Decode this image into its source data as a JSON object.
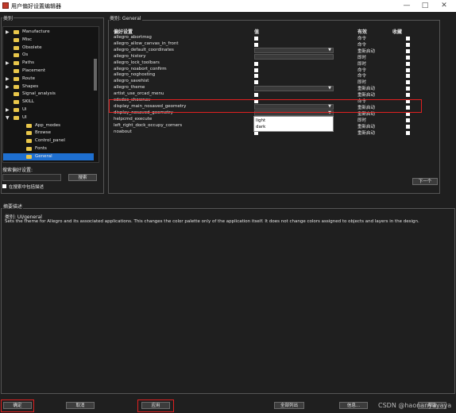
{
  "window": {
    "title": "用户偏好设置编辑器",
    "minimize": "—",
    "maximize": "□",
    "close": "✕"
  },
  "categories_panel": {
    "label": "类别",
    "tree": [
      {
        "label": "Manufacture",
        "expander": "▶",
        "indent": 0
      },
      {
        "label": "Misc",
        "expander": "",
        "indent": 0
      },
      {
        "label": "Obsolete",
        "expander": "",
        "indent": 0
      },
      {
        "label": "Os",
        "expander": "",
        "indent": 0
      },
      {
        "label": "Paths",
        "expander": "▶",
        "indent": 0
      },
      {
        "label": "Placement",
        "expander": "",
        "indent": 0
      },
      {
        "label": "Route",
        "expander": "▶",
        "indent": 0
      },
      {
        "label": "Shapes",
        "expander": "▶",
        "indent": 0
      },
      {
        "label": "Signal_analysis",
        "expander": "",
        "indent": 0
      },
      {
        "label": "SKILL",
        "expander": "",
        "indent": 0
      },
      {
        "label": "Ui",
        "expander": "▶",
        "indent": 0
      },
      {
        "label": "UI",
        "expander": "▼",
        "indent": 0
      },
      {
        "label": "App_modes",
        "expander": "",
        "indent": 1
      },
      {
        "label": "Browse",
        "expander": "",
        "indent": 1
      },
      {
        "label": "Control_panel",
        "expander": "",
        "indent": 1
      },
      {
        "label": "Fonts",
        "expander": "",
        "indent": 1
      },
      {
        "label": "General",
        "expander": "",
        "indent": 1,
        "selected": true
      }
    ],
    "search_label": "搜索偏好设置:",
    "search_value": "",
    "search_button": "搜索",
    "search_in_desc_label": "在搜索中包括描述"
  },
  "settings_panel": {
    "label": "类别: General",
    "headers": {
      "name": "偏好设置",
      "value": "值",
      "effective": "有效",
      "favorite": "收藏"
    },
    "rows": [
      {
        "name": "allegro_abortmsg",
        "value_type": "checkbox",
        "effective": "命令"
      },
      {
        "name": "allegro_allow_canvas_in_front",
        "value_type": "checkbox",
        "effective": "命令"
      },
      {
        "name": "allegro_default_coordinates",
        "value_type": "combo",
        "effective": "重新启动"
      },
      {
        "name": "allegro_history",
        "value_type": "text",
        "effective": "即时"
      },
      {
        "name": "allegro_lock_toolbars",
        "value_type": "checkbox",
        "effective": "即时"
      },
      {
        "name": "allegro_noabort_confirm",
        "value_type": "checkbox",
        "effective": "命令"
      },
      {
        "name": "allegro_noghosting",
        "value_type": "checkbox",
        "effective": "命令"
      },
      {
        "name": "allegro_savehist",
        "value_type": "checkbox",
        "effective": "即时"
      },
      {
        "name": "allegro_theme",
        "value_type": "combo",
        "effective": "重新启动",
        "highlight": true
      },
      {
        "name": "artist_use_orcad_menu",
        "value_type": "checkbox",
        "effective": "重新启动"
      },
      {
        "name": "cdsdoc_shownav",
        "value_type": "checkbox",
        "effective": "命令"
      },
      {
        "name": "display_main_nosaved_geometry",
        "value_type": "combo",
        "effective": "重新启动"
      },
      {
        "name": "display_nosaved_geometry",
        "value_type": "combo",
        "effective": "重新启动"
      },
      {
        "name": "helpcmd_execute",
        "value_type": "checkbox",
        "effective": "即时"
      },
      {
        "name": "left_right_dock_occupy_corners",
        "value_type": "checkbox",
        "effective": "重新启动"
      },
      {
        "name": "noabout",
        "value_type": "checkbox",
        "effective": "重新启动"
      }
    ],
    "theme_dropdown_options": [
      "light",
      "dark"
    ],
    "next_button": "下一个"
  },
  "description_panel": {
    "label": "摘要描述",
    "title": "类别: UI/general",
    "text": "Sets the theme for Allegro and its associated applications. This changes the color palette only of the application itself. It does not change colors assigned to objects and layers in the design."
  },
  "footer": {
    "ok": "确定",
    "cancel": "取消",
    "apply": "应用",
    "list_all": "全部列出",
    "info": "信息...",
    "help": "帮助"
  },
  "watermark": "CSDN @haonanyayaya",
  "colors": {
    "highlight_red": "#e02020",
    "selection_blue": "#1e6fd0",
    "folder_yellow": "#e8c64a"
  }
}
